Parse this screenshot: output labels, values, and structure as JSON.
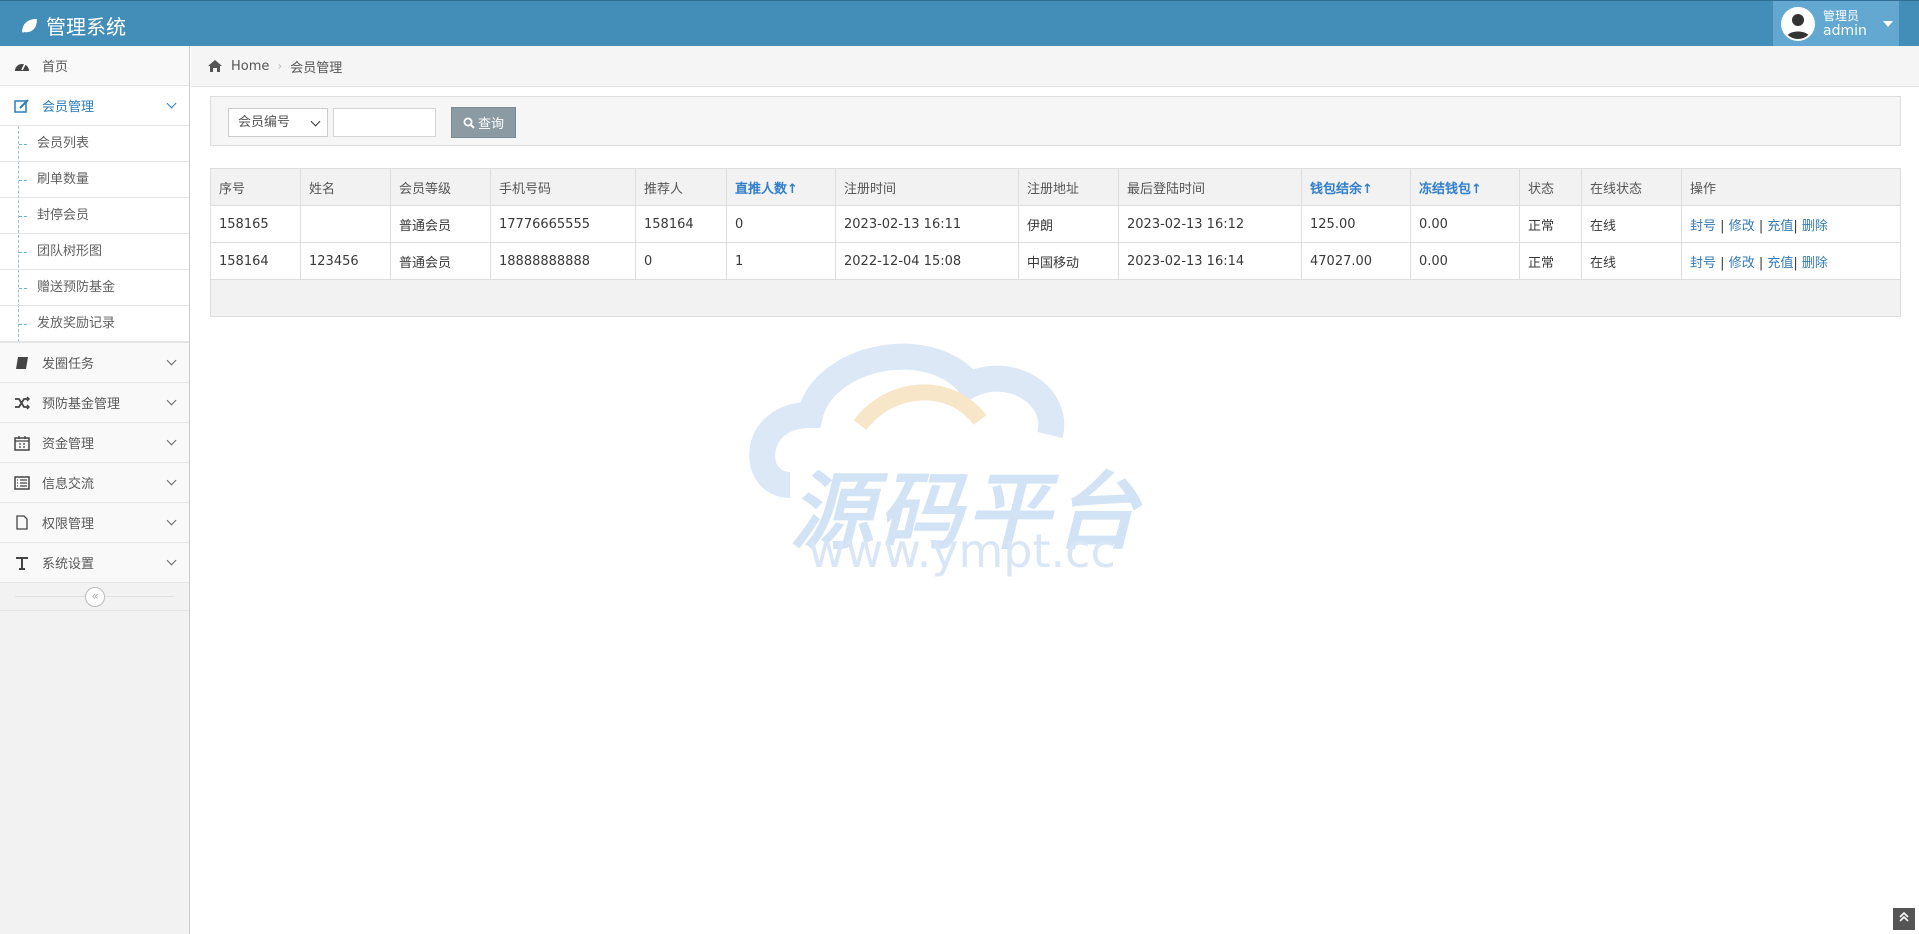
{
  "app": {
    "title": "管理系统"
  },
  "user": {
    "role": "管理员",
    "name": "admin"
  },
  "sidebar": {
    "items": [
      {
        "label": "首页",
        "icon": "dashboard-icon"
      },
      {
        "label": "会员管理",
        "icon": "edit-icon",
        "active": true,
        "children": [
          "会员列表",
          "刷单数量",
          "封停会员",
          "团队树形图",
          "赠送预防基金",
          "发放奖励记录"
        ]
      },
      {
        "label": "发圈任务",
        "icon": "book-icon"
      },
      {
        "label": "预防基金管理",
        "icon": "shuffle-icon"
      },
      {
        "label": "资金管理",
        "icon": "calendar-icon"
      },
      {
        "label": "信息交流",
        "icon": "list-icon"
      },
      {
        "label": "权限管理",
        "icon": "file-icon"
      },
      {
        "label": "系统设置",
        "icon": "text-icon"
      }
    ]
  },
  "breadcrumb": {
    "home": "Home",
    "current": "会员管理"
  },
  "search": {
    "field_selected": "会员编号",
    "input_value": "",
    "button": "查询"
  },
  "table": {
    "headers": [
      "序号",
      "姓名",
      "会员等级",
      "手机号码",
      "推荐人",
      "直推人数↑",
      "注册时间",
      "注册地址",
      "最后登陆时间",
      "钱包结余↑",
      "冻结钱包↑",
      "状态",
      "在线状态",
      "操作"
    ],
    "rows": [
      {
        "id": "158165",
        "name": "",
        "level": "普通会员",
        "phone": "17776665555",
        "referrer": "158164",
        "direct": "0",
        "reg_time": "2023-02-13 16:11",
        "reg_addr": "伊朗",
        "last_login": "2023-02-13 16:12",
        "wallet": "125.00",
        "frozen": "0.00",
        "status": "正常",
        "online": "在线"
      },
      {
        "id": "158164",
        "name": "123456",
        "level": "普通会员",
        "phone": "18888888888",
        "referrer": "0",
        "direct": "1",
        "reg_time": "2022-12-04 15:08",
        "reg_addr": "中国移动",
        "last_login": "2023-02-13 16:14",
        "wallet": "47027.00",
        "frozen": "0.00",
        "status": "正常",
        "online": "在线"
      }
    ],
    "actions": {
      "ban": "封号",
      "edit": "修改",
      "recharge": "充值",
      "delete": "删除",
      "sep": "|"
    }
  },
  "watermark": {
    "title": "源码平台",
    "url": "www.ympt.cc"
  },
  "colors": {
    "navbar": "#438eb9",
    "user_box": "#62a8d1",
    "link": "#337ab7",
    "online": "#d15b47",
    "sort_header": "#307ecc"
  }
}
